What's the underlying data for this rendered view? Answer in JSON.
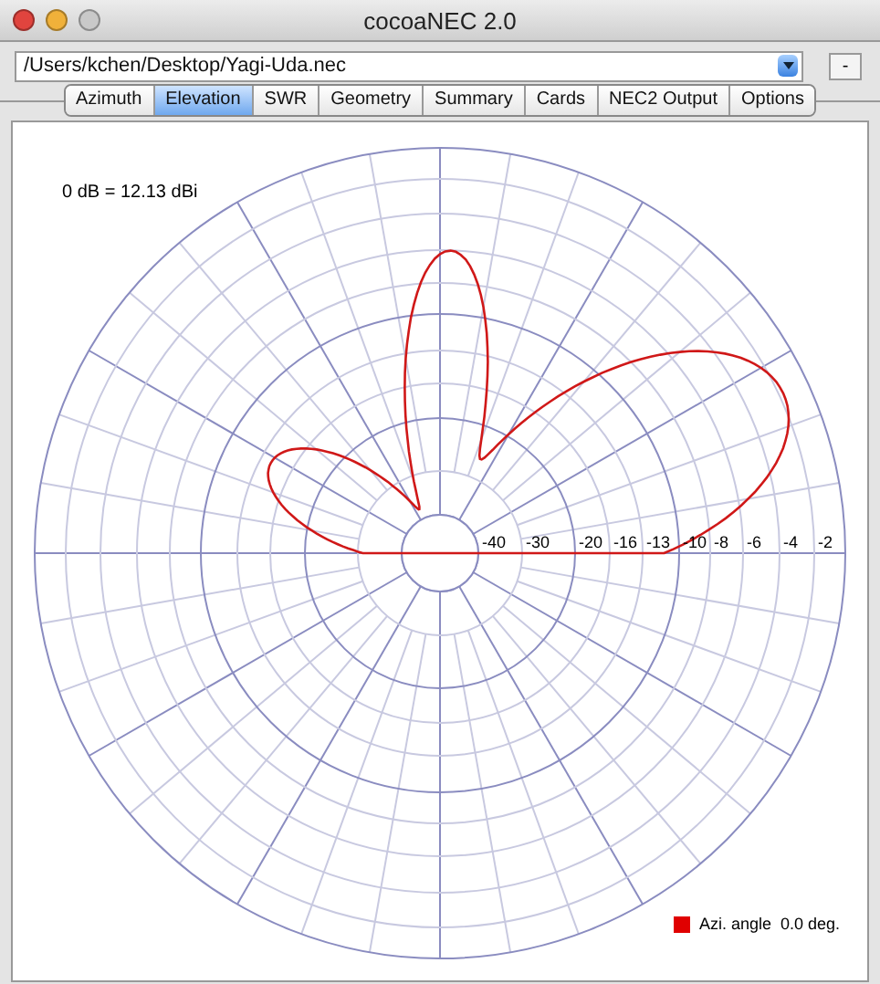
{
  "window": {
    "title": "cocoaNEC 2.0"
  },
  "file_path": {
    "value": "/Users/kchen/Desktop/Yagi-Uda.nec"
  },
  "side_button": "-",
  "tabs": [
    {
      "label": "Azimuth",
      "selected": false
    },
    {
      "label": "Elevation",
      "selected": true
    },
    {
      "label": "SWR",
      "selected": false
    },
    {
      "label": "Geometry",
      "selected": false
    },
    {
      "label": "Summary",
      "selected": false
    },
    {
      "label": "Cards",
      "selected": false
    },
    {
      "label": "NEC2 Output",
      "selected": false
    },
    {
      "label": "Options",
      "selected": false
    }
  ],
  "plot": {
    "reference": "0 dB = 12.13 dBi",
    "ring_labels": [
      "-40",
      "-30",
      "-20",
      "-16",
      "-13",
      "-10",
      "-8",
      "-6",
      "-4",
      "-2"
    ],
    "legend": "Azi. angle  0.0 deg."
  }
}
